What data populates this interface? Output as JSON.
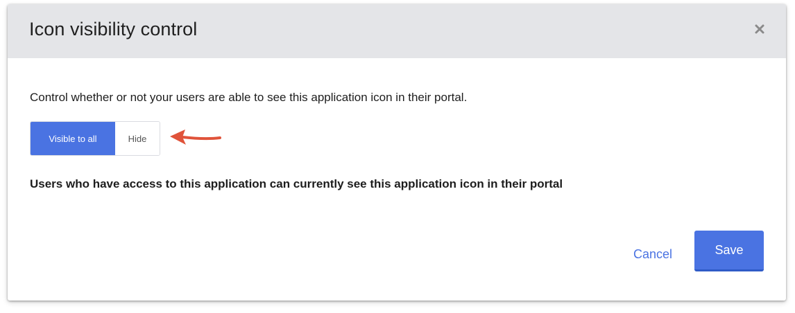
{
  "dialog": {
    "title": "Icon visibility control",
    "close_icon": "close-icon",
    "description": "Control whether or not your users are able to see this application icon in their portal.",
    "toggle": {
      "options": [
        "Visible to all",
        "Hide"
      ],
      "selected": "Visible to all"
    },
    "status_text": "Users who have access to this application can currently see this application icon in their portal",
    "cancel_label": "Cancel",
    "save_label": "Save"
  },
  "colors": {
    "accent": "#4a73e2",
    "header_bg": "#e4e5e8",
    "annotation_arrow": "#e0533a"
  }
}
